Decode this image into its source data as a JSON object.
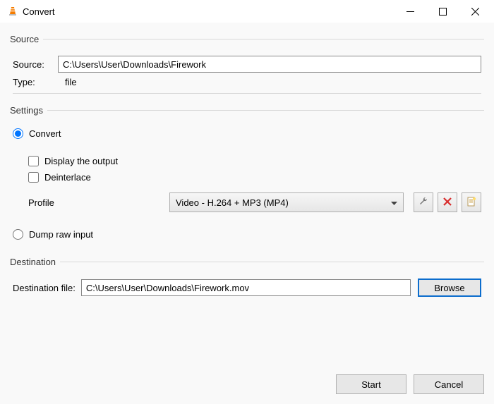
{
  "window": {
    "title": "Convert"
  },
  "source": {
    "legend": "Source",
    "source_label": "Source:",
    "source_value": "C:\\Users\\User\\Downloads\\Firework",
    "type_label": "Type:",
    "type_value": "file"
  },
  "settings": {
    "legend": "Settings",
    "convert_label": "Convert",
    "display_output_label": "Display the output",
    "deinterlace_label": "Deinterlace",
    "profile_label": "Profile",
    "profile_value": "Video - H.264 + MP3 (MP4)",
    "dump_label": "Dump raw input"
  },
  "destination": {
    "legend": "Destination",
    "dest_label": "Destination file:",
    "dest_value": "C:\\Users\\User\\Downloads\\Firework.mov",
    "browse_label": "Browse"
  },
  "footer": {
    "start_label": "Start",
    "cancel_label": "Cancel"
  }
}
